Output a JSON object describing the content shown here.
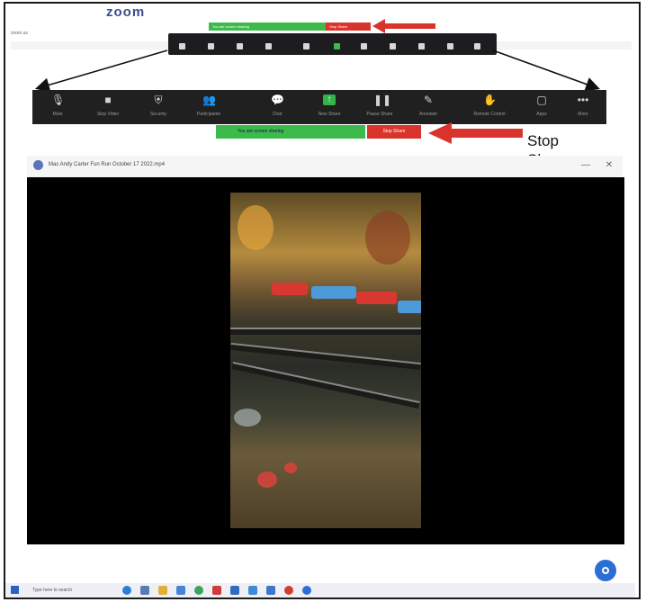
{
  "mini_browser": {
    "logo": "zoom",
    "share_text": "You are screen sharing",
    "stop_text": "Stop Share",
    "url": "zoom.us",
    "tabs": [
      "",
      "",
      ""
    ],
    "account_text": ""
  },
  "toolbar": {
    "items": [
      {
        "label": "Mute",
        "icon": "microphone-icon",
        "glyph": "🎙"
      },
      {
        "label": "Stop Video",
        "icon": "video-camera-icon",
        "glyph": "■"
      },
      {
        "label": "Security",
        "icon": "shield-icon",
        "glyph": "⛨"
      },
      {
        "label": "Participants",
        "icon": "participants-icon",
        "glyph": "👥"
      },
      {
        "label": "Chat",
        "icon": "chat-icon",
        "glyph": "💬"
      },
      {
        "label": "New Share",
        "icon": "share-screen-icon",
        "glyph": "↑"
      },
      {
        "label": "Pause Share",
        "icon": "pause-icon",
        "glyph": "❚❚"
      },
      {
        "label": "Annotate",
        "icon": "annotate-icon",
        "glyph": "✎"
      },
      {
        "label": "Remote Control",
        "icon": "remote-control-icon",
        "glyph": "✋"
      },
      {
        "label": "Apps",
        "icon": "apps-icon",
        "glyph": "▢"
      },
      {
        "label": "More",
        "icon": "more-icon",
        "glyph": "•••"
      }
    ]
  },
  "share_bar": {
    "status_text": "You are screen sharing",
    "stop_label": "Stop Share"
  },
  "annotation": {
    "line1": "Stop",
    "line2": "Share"
  },
  "video_window": {
    "title": "Mac Andy Carter Fun Run October 17 2022.mp4",
    "minimize": "—",
    "close": "✕"
  },
  "taskbar": {
    "search_placeholder": "Type here to search",
    "tray_text": "",
    "time": ""
  },
  "colors": {
    "share_green": "#3cba4c",
    "stop_red": "#d9342b",
    "toolbar_bg": "#202020",
    "zoom_blue": "#2b6fd6"
  }
}
